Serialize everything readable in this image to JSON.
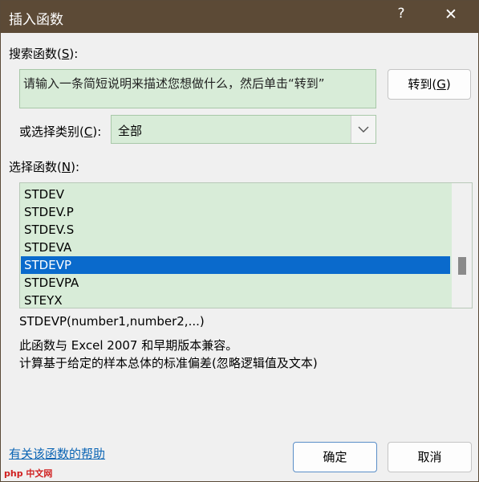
{
  "window": {
    "title": "插入函数",
    "help_glyph": "?",
    "close_glyph": "✕"
  },
  "search": {
    "label_prefix": "搜索函数(",
    "label_key": "S",
    "label_suffix": "):",
    "input_text": "请输入一条简短说明来描述您想做什么，然后单击“转到”",
    "go_prefix": "转到(",
    "go_key": "G",
    "go_suffix": ")"
  },
  "category": {
    "label_prefix": "或选择类别(",
    "label_key": "C",
    "label_suffix": "):",
    "selected": "全部"
  },
  "functions": {
    "label_prefix": "选择函数(",
    "label_key": "N",
    "label_suffix": "):",
    "items": [
      "STDEV",
      "STDEV.P",
      "STDEV.S",
      "STDEVA",
      "STDEVP",
      "STDEVPA",
      "STEYX"
    ],
    "selected_index": 4
  },
  "description": {
    "signature": "STDEVP(number1,number2,...)",
    "line1": "此函数与 Excel 2007 和早期版本兼容。",
    "line2": "计算基于给定的样本总体的标准偏差(忽略逻辑值及文本)"
  },
  "footer": {
    "help_link": "有关该函数的帮助",
    "ok": "确定",
    "cancel": "取消"
  },
  "watermark": "php 中文网",
  "colors": {
    "titlebar": "#5c4a36",
    "field_bg": "#d8ecd8",
    "selection": "#0a6acc",
    "link": "#0a64b4"
  }
}
